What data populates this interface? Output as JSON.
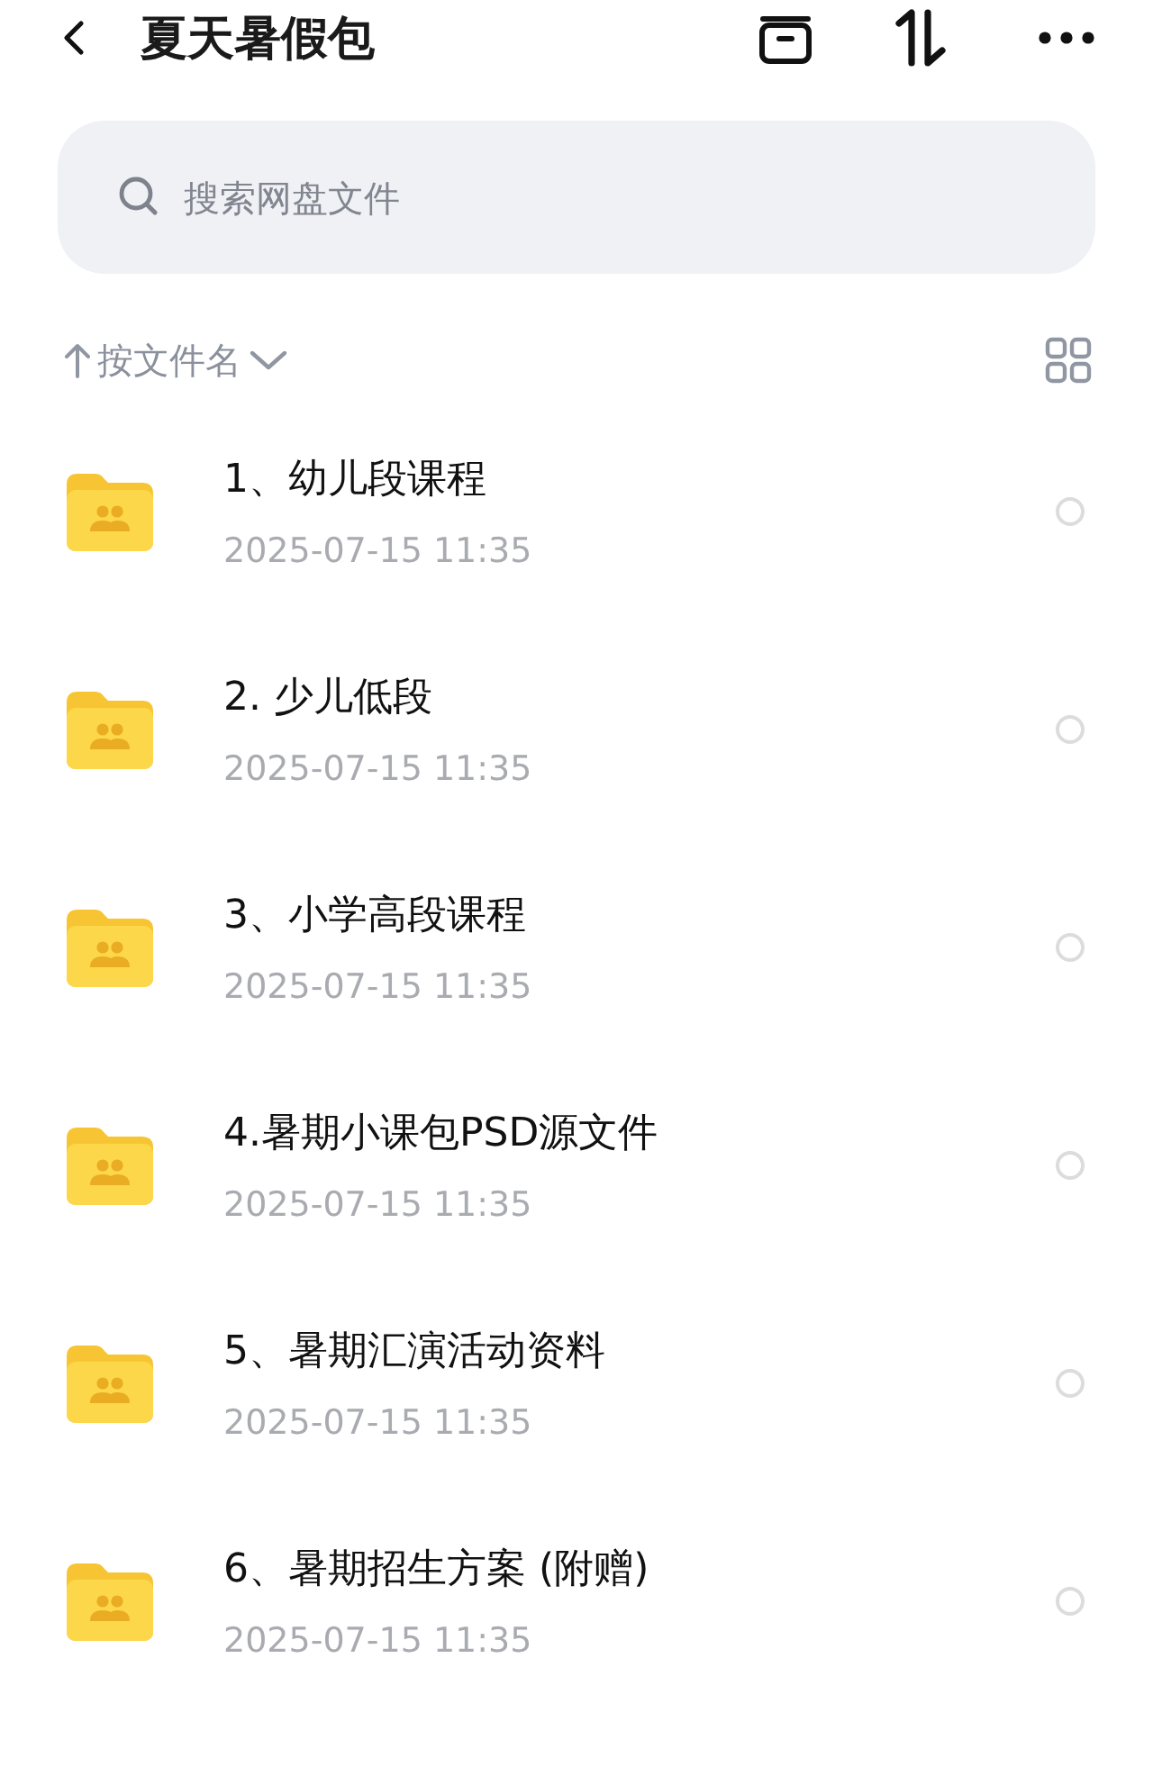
{
  "header": {
    "title": "夏天暑假包"
  },
  "search": {
    "placeholder": "搜索网盘文件"
  },
  "sort": {
    "label": "按文件名"
  },
  "files": [
    {
      "name": "1、幼儿段课程",
      "date": "2025-07-15  11:35",
      "selected": false
    },
    {
      "name": "2.  少儿低段",
      "date": "2025-07-15  11:35",
      "selected": false
    },
    {
      "name": "3、小学高段课程",
      "date": "2025-07-15  11:35",
      "selected": false
    },
    {
      "name": "4.暑期小课包PSD源文件",
      "date": "2025-07-15  11:35",
      "selected": false
    },
    {
      "name": "5、暑期汇演活动资料",
      "date": "2025-07-15  11:35",
      "selected": false
    },
    {
      "name": "6、暑期招生方案 (附赠)",
      "date": "2025-07-15  11:35",
      "selected": false
    }
  ]
}
